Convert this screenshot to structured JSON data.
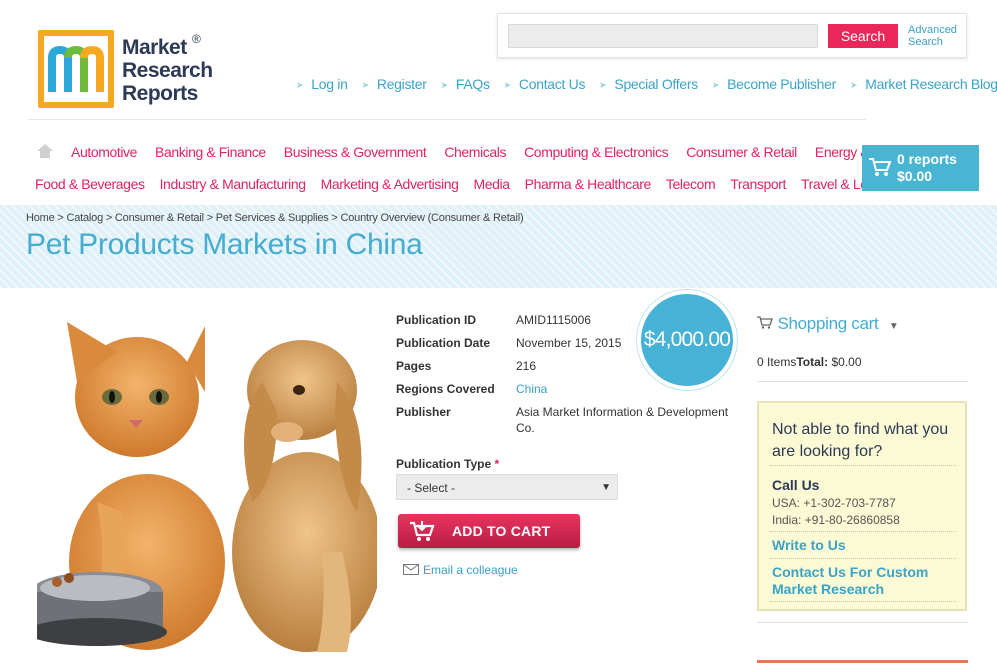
{
  "logo": {
    "line1": "Market",
    "line2": "Research",
    "line3": "Reports",
    "reg": "®"
  },
  "search": {
    "placeholder": "",
    "button": "Search",
    "advanced_line1": "Advanced",
    "advanced_line2": "Search"
  },
  "toplinks": [
    "Log in",
    "Register",
    "FAQs",
    "Contact Us",
    "Special Offers",
    "Become Publisher",
    "Market Research Blog"
  ],
  "categories_row1": [
    "Automotive",
    "Banking & Finance",
    "Business & Government",
    "Chemicals",
    "Computing & Electronics",
    "Consumer & Retail",
    "Energy & Utilities"
  ],
  "categories_row2": [
    "Food & Beverages",
    "Industry & Manufacturing",
    "Marketing & Advertising",
    "Media",
    "Pharma & Healthcare",
    "Telecom",
    "Transport",
    "Travel & Leisure"
  ],
  "cart": {
    "count": "0 reports",
    "total": "$0.00"
  },
  "breadcrumb": "Home > Catalog > Consumer & Retail > Pet Services & Supplies > Country Overview (Consumer & Retail)",
  "page_title": "Pet Products Markets in China",
  "details": {
    "pub_id_label": "Publication ID",
    "pub_id": "AMID1115006",
    "pub_date_label": "Publication Date",
    "pub_date": "November 15, 2015",
    "pages_label": "Pages",
    "pages": "216",
    "regions_label": "Regions Covered",
    "regions": "China",
    "publisher_label": "Publisher",
    "publisher": "Asia Market Information & Development Co."
  },
  "price": "$4,000.00",
  "pubtype": {
    "label": "Publication Type",
    "required": "*",
    "selected": "- Select -"
  },
  "add_to_cart": "ADD TO CART",
  "email_colleague": "Email a colleague",
  "shopping_cart": {
    "title": "Shopping cart",
    "items": "0 Items",
    "total_label": "Total:",
    "total": "$0.00"
  },
  "help": {
    "heading": "Not able to find what you are looking for?",
    "call_us": "Call Us",
    "usa": "USA: +1-302-703-7787",
    "india": "India: +91-80-26860858",
    "write_to_us": "Write to Us",
    "custom_research": "Contact Us For Custom Market Research"
  },
  "colors": {
    "accent_pink": "#e9275b",
    "accent_blue": "#45acd2"
  }
}
